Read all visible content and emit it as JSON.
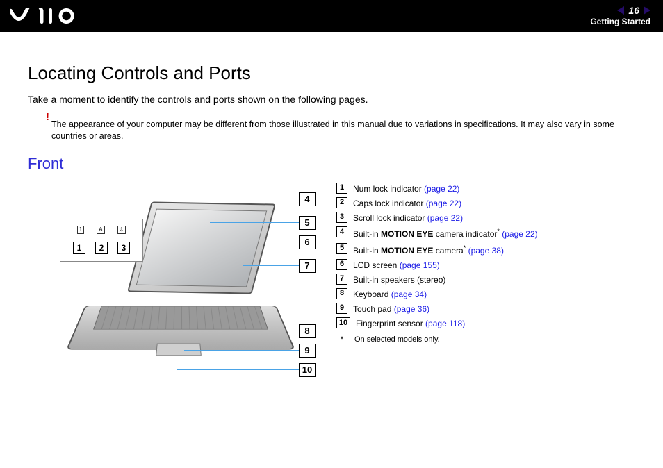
{
  "header": {
    "page_number": "16",
    "section": "Getting Started"
  },
  "title": "Locating Controls and Ports",
  "intro": "Take a moment to identify the controls and ports shown on the following pages.",
  "note_mark": "!",
  "note": "The appearance of your computer may be different from those illustrated in this manual due to variations in specifications. It may also vary in some countries or areas.",
  "subhead": "Front",
  "inset": {
    "icons": [
      "1",
      "A",
      "⇳"
    ],
    "nums": [
      "1",
      "2",
      "3"
    ]
  },
  "callouts_right": [
    "4",
    "5",
    "6",
    "7"
  ],
  "callouts_bottom": [
    "8",
    "9",
    "10"
  ],
  "legend": [
    {
      "n": "1",
      "pre": "Num lock indicator ",
      "link": "(page 22)"
    },
    {
      "n": "2",
      "pre": "Caps lock indicator ",
      "link": "(page 22)"
    },
    {
      "n": "3",
      "pre": "Scroll lock indicator ",
      "link": "(page 22)"
    },
    {
      "n": "4",
      "pre": "Built-in ",
      "bold": "MOTION EYE",
      "post": " camera indicator",
      "sup": "*",
      "link": " (page 22)"
    },
    {
      "n": "5",
      "pre": "Built-in ",
      "bold": "MOTION EYE",
      "post": " camera",
      "sup": "*",
      "link": " (page 38)"
    },
    {
      "n": "6",
      "pre": "LCD screen ",
      "link": "(page 155)"
    },
    {
      "n": "7",
      "pre": "Built-in speakers (stereo)"
    },
    {
      "n": "8",
      "pre": "Keyboard ",
      "link": "(page 34)"
    },
    {
      "n": "9",
      "pre": "Touch pad ",
      "link": "(page 36)"
    },
    {
      "n": "10",
      "pre": "Fingerprint sensor ",
      "link": "(page 118)"
    }
  ],
  "footnote": {
    "mark": "*",
    "text": "On selected models only."
  }
}
